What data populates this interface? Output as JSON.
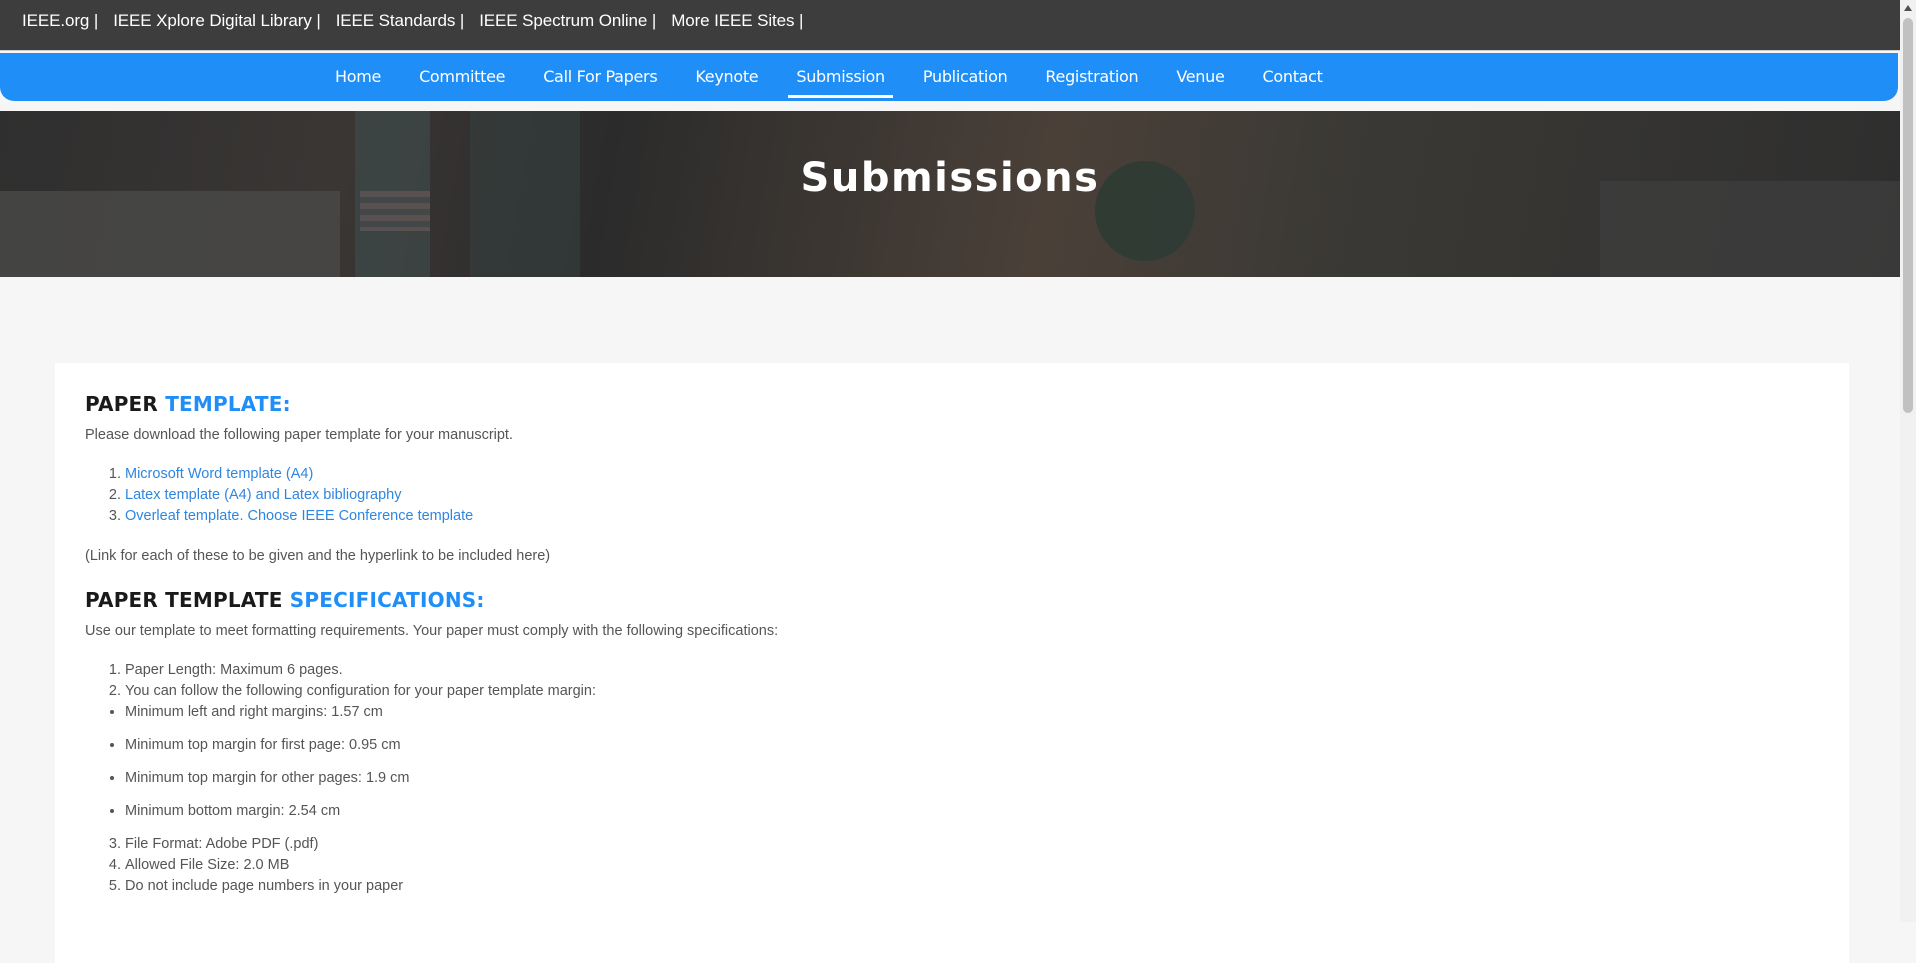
{
  "top_links": [
    "IEEE.org |",
    "IEEE Xplore Digital Library |",
    "IEEE Standards |",
    "IEEE Spectrum Online |",
    "More IEEE Sites |"
  ],
  "nav": {
    "items": [
      "Home",
      "Committee",
      "Call For Papers",
      "Keynote",
      "Submission",
      "Publication",
      "Registration",
      "Venue",
      "Contact"
    ],
    "active": "Submission"
  },
  "hero": {
    "title": "Submissions"
  },
  "paper_template": {
    "heading_main": "PAPER ",
    "heading_accent": "TEMPLATE:",
    "intro": "Please download the following paper template for your manuscript.",
    "links": [
      "Microsoft Word template (A4)",
      "Latex template (A4) and Latex bibliography",
      "Overleaf template. Choose IEEE Conference template"
    ],
    "note": "(Link for each of these to be given and the hyperlink to be included here)"
  },
  "specifications": {
    "heading_main": "PAPER TEMPLATE ",
    "heading_accent": "SPECIFICATIONS:",
    "intro": "Use our template to meet formatting requirements. Your paper must comply with the following specifications:",
    "items_first": [
      "Paper Length: Maximum 6 pages.",
      "You can follow the following configuration for your paper template margin:"
    ],
    "margins": [
      "Minimum left and right margins: 1.57 cm",
      "Minimum top margin for first page: 0.95 cm",
      "Minimum top margin for other pages: 1.9 cm",
      "Minimum bottom margin: 2.54 cm"
    ],
    "items_rest": [
      "File Format: Adobe PDF (.pdf)",
      "Allowed File Size: 2.0 MB",
      "Do not include page numbers in your paper"
    ]
  },
  "colors": {
    "accent": "#1f8ef7",
    "topbar": "#3d3d3d"
  }
}
